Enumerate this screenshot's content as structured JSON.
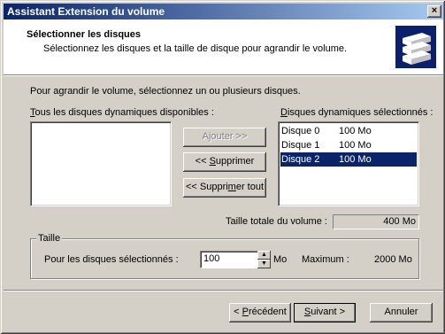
{
  "window": {
    "title": "Assistant Extension du volume",
    "close_glyph": "×"
  },
  "header": {
    "title": "Sélectionner les disques",
    "subtitle": "Sélectionnez les disques et la taille de disque pour agrandir le volume.",
    "icon": "disk-stack-icon"
  },
  "instruction": "Pour agrandir le volume, sélectionnez un ou plusieurs disques.",
  "available": {
    "label_first": "T",
    "label_rest": "ous les disques dynamiques disponibles :",
    "items": []
  },
  "selected": {
    "label_first": "D",
    "label_rest": "isques dynamiques sélectionnés :",
    "items": [
      {
        "name": "Disque 0",
        "size": "100 Mo",
        "selected": false
      },
      {
        "name": "Disque 1",
        "size": "100 Mo",
        "selected": false
      },
      {
        "name": "Disque 2",
        "size": "100 Mo",
        "selected": true
      }
    ]
  },
  "buttons": {
    "add_pre": "A",
    "add_ul": "j",
    "add_post": "outer >>",
    "remove_pre": "<< ",
    "remove_ul": "S",
    "remove_post": "upprimer",
    "remove_all_pre": "<< Suppri",
    "remove_all_ul": "m",
    "remove_all_post": "er tout"
  },
  "total": {
    "label": "Taille totale du volume :",
    "value": "400 Mo"
  },
  "size_group": {
    "label": "Taille",
    "field_label": "Pour les disques sélectionnés :",
    "value": "100",
    "unit": "Mo",
    "max_label": "Maximum :",
    "max_value": "2000 Mo"
  },
  "footer": {
    "back_pre": "< ",
    "back_ul": "P",
    "back_post": "récédent",
    "next_ul": "S",
    "next_post": "uivant >",
    "cancel": "Annuler"
  },
  "colors": {
    "selection": "#0a246a",
    "titlebar_start": "#0a246a",
    "titlebar_end": "#a6caf0"
  }
}
